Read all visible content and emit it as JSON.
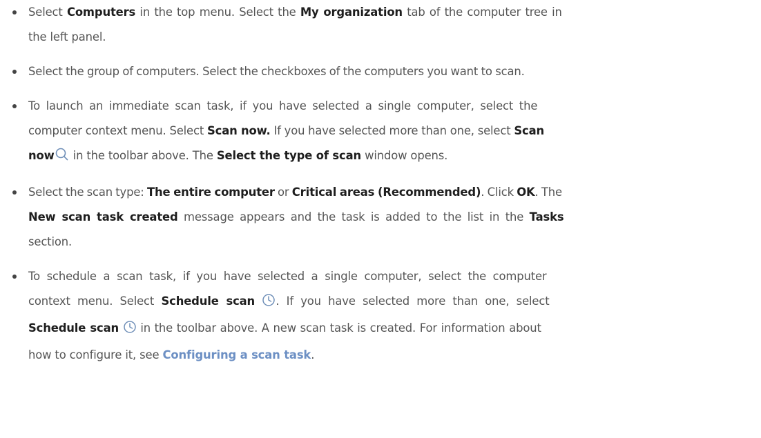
{
  "steps": [
    {
      "lines": [
        {
          "parts": [
            "Select ",
            "Computers",
            " in the top menu. Select the ",
            "My organization",
            " tab of the computer tree in"
          ]
        },
        {
          "parts": [
            "the left panel."
          ]
        }
      ]
    },
    {
      "lines": [
        {
          "parts": [
            "Select the group of computers. Select the checkboxes of the computers you want to scan."
          ]
        }
      ]
    },
    {
      "lines": [
        {
          "parts": [
            "To launch an immediate scan task, if you have selected a single computer, select the"
          ]
        },
        {
          "parts": [
            "computer context menu. Select ",
            "Scan now.",
            " If you have selected more than one, select ",
            "Scan"
          ]
        },
        {
          "parts": [
            "now",
            " in the toolbar above. The ",
            "Select the type of scan",
            " window opens."
          ]
        }
      ]
    },
    {
      "lines": [
        {
          "parts": [
            "Select the scan type: ",
            "The entire computer",
            " or ",
            "Critical areas (Recommended)",
            ". Click ",
            "OK",
            ". The"
          ]
        },
        {
          "parts": [
            "New scan task created",
            " message appears and the task is added to the list in the ",
            "Tasks"
          ]
        },
        {
          "parts": [
            "section."
          ]
        }
      ]
    },
    {
      "lines": [
        {
          "parts": [
            "To schedule a scan task, if you have selected a single computer, select the computer"
          ]
        },
        {
          "parts": [
            "context menu. Select ",
            "Schedule scan",
            ". If you have selected more than one, select"
          ]
        },
        {
          "parts": [
            "Schedule scan",
            " in the toolbar above. A new scan task is created. For information about"
          ]
        },
        {
          "parts": [
            "how to configure it, see ",
            "Configuring a scan task",
            "."
          ]
        }
      ]
    }
  ],
  "icons": {
    "scan_now": "search-icon",
    "schedule_scan": "clock-icon"
  }
}
